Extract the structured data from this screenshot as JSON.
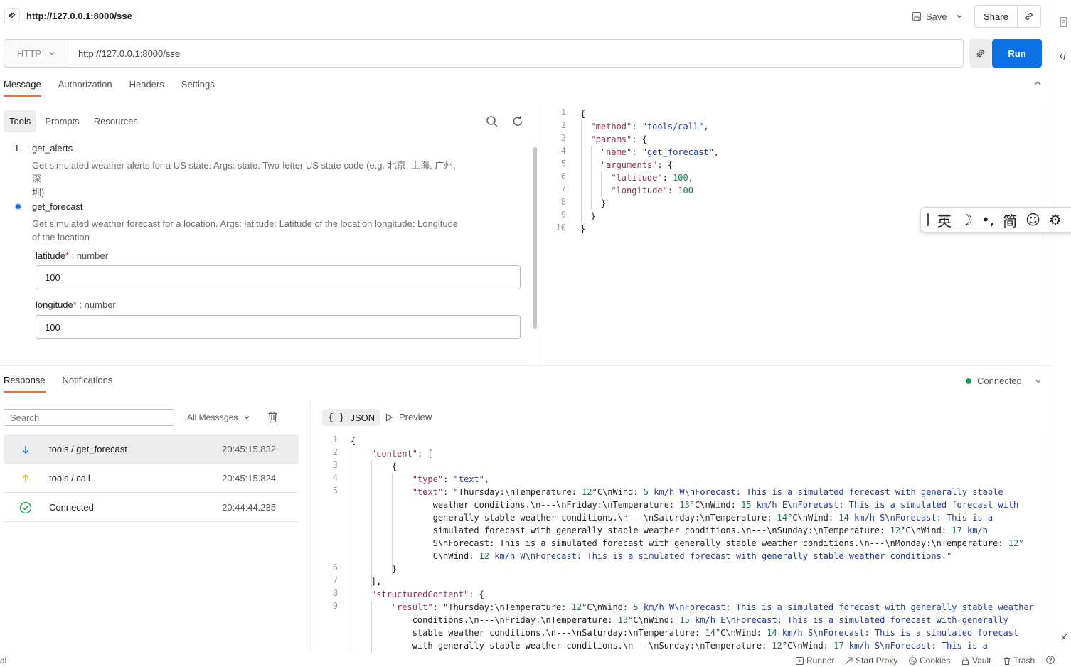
{
  "request": {
    "title": "http://127.0.0.1:8000/sse",
    "save_label": "Save",
    "share_label": "Share",
    "method": "HTTP",
    "url": "http://127.0.0.1:8000/sse",
    "run_label": "Run"
  },
  "tabs": [
    "Message",
    "Authorization",
    "Headers",
    "Settings"
  ],
  "subtabs": [
    "Tools",
    "Prompts",
    "Resources"
  ],
  "tools": [
    {
      "index": "1.",
      "name": "get_alerts",
      "desc1": "Get simulated weather alerts for a US state. Args: state: Two-letter US state code (e.g. 北京, 上海, 广州, 深",
      "desc2": "圳)"
    },
    {
      "name": "get_forecast",
      "desc1": "Get simulated weather forecast for a location. Args: latitude: Latitude of the location longitude: Longitude",
      "desc2": "of the location"
    }
  ],
  "fields": [
    {
      "name": "latitude",
      "req": "*",
      "type": " : number",
      "value": "100"
    },
    {
      "name": "longitude",
      "req": "*",
      "type": " : number",
      "value": "100"
    }
  ],
  "request_code": [
    "{",
    "  \"method\": \"tools/call\",",
    "  \"params\": {",
    "    \"name\": \"get_forecast\",",
    "    \"arguments\": {",
    "      \"latitude\": 100,",
    "      \"longitude\": 100",
    "    }",
    "  }",
    "}"
  ],
  "ime": [
    "英",
    "☽",
    "•,",
    "简",
    "☺",
    "⚙"
  ],
  "response": {
    "tabs": [
      "Response",
      "Notifications"
    ],
    "status": "Connected",
    "search_placeholder": "Search",
    "filter": "All Messages",
    "json_label": "JSON",
    "preview_label": "Preview",
    "messages": [
      {
        "label": "tools / get_forecast",
        "time": "20:45:15.832",
        "icon": "arrow-down-icon"
      },
      {
        "label": "tools / call",
        "time": "20:45:15.824",
        "icon": "arrow-up-icon"
      },
      {
        "label": "Connected",
        "time": "20:44:44.235",
        "icon": "check-circle-icon"
      }
    ],
    "code_lines": [
      {
        "n": "1",
        "text": "{"
      },
      {
        "n": "2",
        "text": "    \"content\": ["
      },
      {
        "n": "3",
        "text": "        {"
      },
      {
        "n": "4",
        "text": "            \"type\": \"text\","
      },
      {
        "n": "5",
        "text": "            \"text\": \"Thursday:\\nTemperature: 12°C\\nWind: 5 km/h W\\nForecast: This is a simulated forecast with generally stable"
      },
      {
        "n": "",
        "text": "                weather conditions.\\n---\\nFriday:\\nTemperature: 13°C\\nWind: 15 km/h E\\nForecast: This is a simulated forecast with"
      },
      {
        "n": "",
        "text": "                generally stable weather conditions.\\n---\\nSaturday:\\nTemperature: 14°C\\nWind: 14 km/h S\\nForecast: This is a"
      },
      {
        "n": "",
        "text": "                simulated forecast with generally stable weather conditions.\\n---\\nSunday:\\nTemperature: 12°C\\nWind: 17 km/h"
      },
      {
        "n": "",
        "text": "                S\\nForecast: This is a simulated forecast with generally stable weather conditions.\\n---\\nMonday:\\nTemperature: 12°"
      },
      {
        "n": "",
        "text": "                C\\nWind: 12 km/h W\\nForecast: This is a simulated forecast with generally stable weather conditions.\""
      },
      {
        "n": "6",
        "text": "        }"
      },
      {
        "n": "7",
        "text": "    ],"
      },
      {
        "n": "8",
        "text": "    \"structuredContent\": {"
      },
      {
        "n": "9",
        "text": "        \"result\": \"Thursday:\\nTemperature: 12°C\\nWind: 5 km/h W\\nForecast: This is a simulated forecast with generally stable weather"
      },
      {
        "n": "",
        "text": "            conditions.\\n---\\nFriday:\\nTemperature: 13°C\\nWind: 15 km/h E\\nForecast: This is a simulated forecast with generally"
      },
      {
        "n": "",
        "text": "            stable weather conditions.\\n---\\nSaturday:\\nTemperature: 14°C\\nWind: 14 km/h S\\nForecast: This is a simulated forecast"
      },
      {
        "n": "",
        "text": "            with generally stable weather conditions.\\n---\\nSunday:\\nTemperature: 12°C\\nWind: 17 km/h S\\nForecast: This is a"
      }
    ]
  },
  "statusbar": {
    "left": "al",
    "items": [
      "Runner",
      "Start Proxy",
      "Cookies",
      "Vault",
      "Trash"
    ]
  },
  "colors": {
    "accent": "#0c71e5",
    "tab_underline": "#f26b3a",
    "connected": "#1aa34a"
  }
}
